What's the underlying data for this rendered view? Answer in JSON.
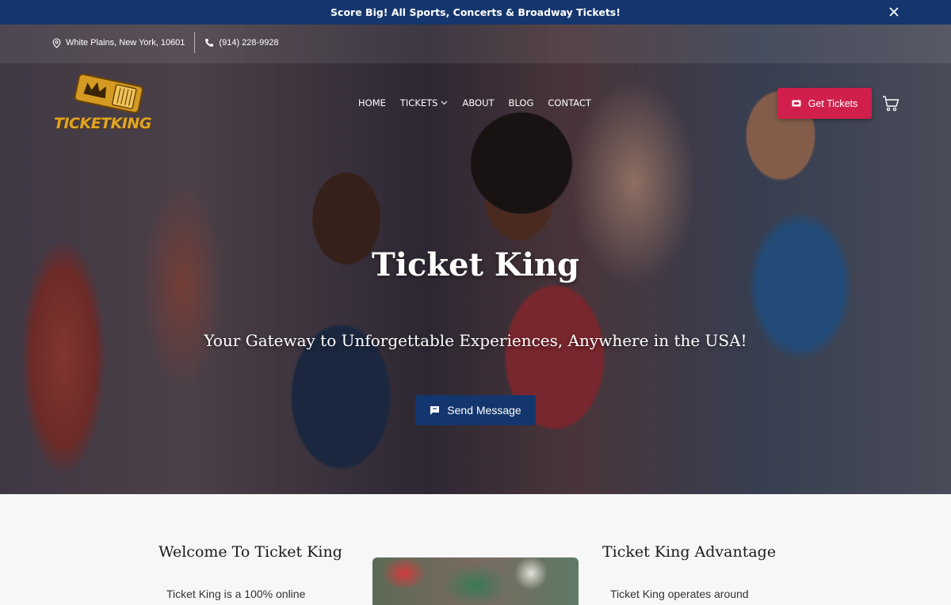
{
  "announcement": {
    "text": "Score Big! All Sports, Concerts & Broadway Tickets!"
  },
  "contact": {
    "address": "White Plains, New York, 10601",
    "phone": "(914) 228-9928"
  },
  "logo": {
    "text": "TICKETKING"
  },
  "nav": {
    "items": [
      "HOME",
      "TICKETS",
      "ABOUT",
      "BLOG",
      "CONTACT"
    ]
  },
  "cta": {
    "get_tickets": "Get Tickets",
    "send_message": "Send Message"
  },
  "hero": {
    "title": "Ticket King",
    "subtitle": "Your Gateway to Unforgettable Experiences, Anywhere in the USA!"
  },
  "sections": {
    "welcome": {
      "title": "Welcome To Ticket King",
      "text": "Ticket King is a 100% online"
    },
    "advantage": {
      "title": "Ticket King Advantage",
      "text": "Ticket King operates around"
    }
  },
  "colors": {
    "brand_navy": "#14366e",
    "accent_red": "#d01f4b",
    "logo_gold": "#e0a526"
  },
  "icons": [
    "close-icon",
    "map-pin-icon",
    "phone-icon",
    "crown-ticket-icon",
    "chevron-down-icon",
    "ticket-icon",
    "cart-icon",
    "chat-icon"
  ]
}
